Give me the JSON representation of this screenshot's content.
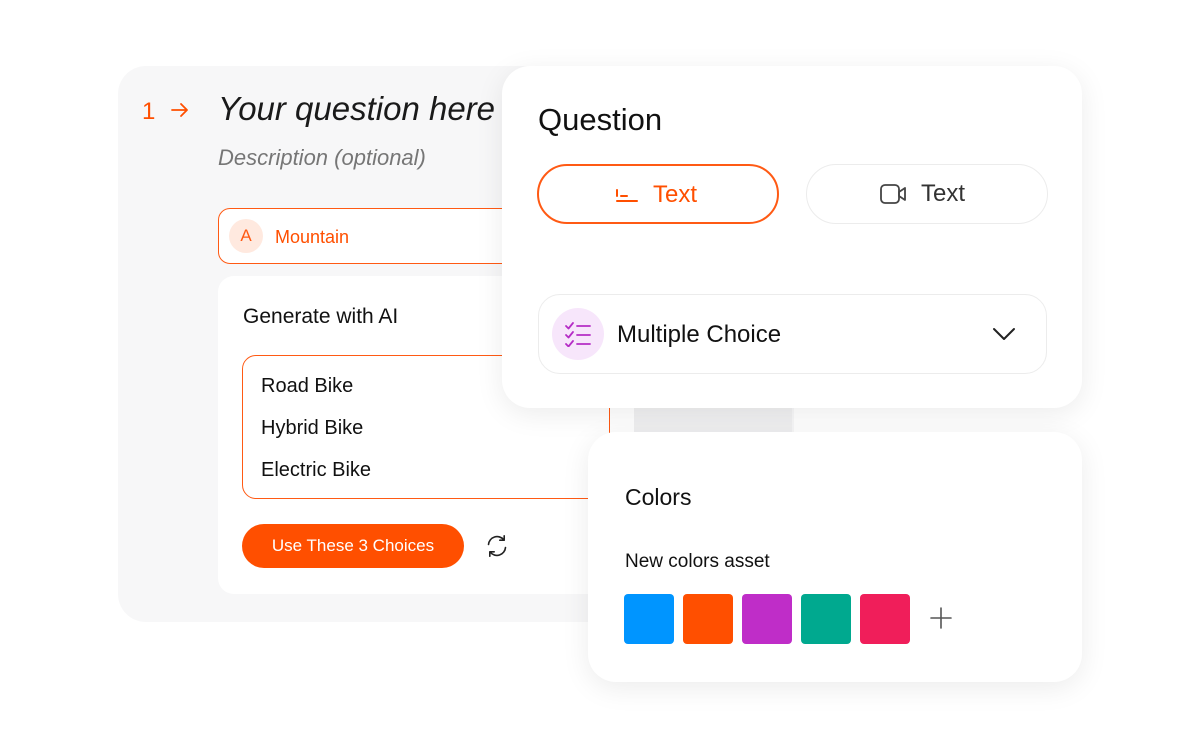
{
  "editor": {
    "number": "1",
    "title": "Your question here",
    "description_placeholder": "Description (optional)",
    "choice": {
      "key": "A",
      "label": "Mountain"
    }
  },
  "ai_panel": {
    "title": "Generate with AI",
    "choices": [
      "Road Bike",
      "Hybrid Bike",
      "Electric Bike"
    ],
    "use_button": "Use These 3 Choices",
    "refresh_icon": "refresh-icon"
  },
  "question_type": {
    "heading": "Question",
    "options": [
      {
        "label": "Text",
        "icon": "short-text-icon",
        "active": true
      },
      {
        "label": "Text",
        "icon": "video-icon",
        "active": false
      }
    ],
    "select": {
      "label": "Multiple Choice",
      "icon": "checklist-icon"
    }
  },
  "colors": {
    "heading": "Colors",
    "asset_name": "New colors asset",
    "swatches": [
      "#0095ff",
      "#ff4f00",
      "#bf2dc8",
      "#00a98f",
      "#f01e5a"
    ],
    "add_icon": "plus-icon"
  },
  "theme": {
    "accent": "#ff4f00"
  }
}
